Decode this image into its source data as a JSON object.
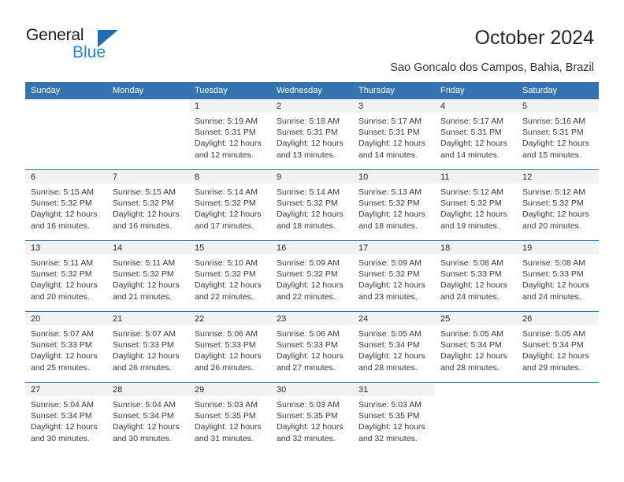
{
  "logo": {
    "word_top": "General",
    "word_bottom": "Blue",
    "triangle_color": "#1f6cb0",
    "blue_color": "#2288dd"
  },
  "header": {
    "title": "October 2024",
    "location": "Sao Goncalo dos Campos, Bahia, Brazil"
  },
  "theme": {
    "header_blue": "#3572b0",
    "daynum_band": "#f2f2f2"
  },
  "calendar": {
    "weekday_headers": [
      "Sunday",
      "Monday",
      "Tuesday",
      "Wednesday",
      "Thursday",
      "Friday",
      "Saturday"
    ],
    "weeks": [
      [
        {
          "day": "",
          "blank": true
        },
        {
          "day": "",
          "blank": true
        },
        {
          "day": "1",
          "sunrise": "Sunrise: 5:19 AM",
          "sunset": "Sunset: 5:31 PM",
          "daylight1": "Daylight: 12 hours",
          "daylight2": "and 12 minutes."
        },
        {
          "day": "2",
          "sunrise": "Sunrise: 5:18 AM",
          "sunset": "Sunset: 5:31 PM",
          "daylight1": "Daylight: 12 hours",
          "daylight2": "and 13 minutes."
        },
        {
          "day": "3",
          "sunrise": "Sunrise: 5:17 AM",
          "sunset": "Sunset: 5:31 PM",
          "daylight1": "Daylight: 12 hours",
          "daylight2": "and 14 minutes."
        },
        {
          "day": "4",
          "sunrise": "Sunrise: 5:17 AM",
          "sunset": "Sunset: 5:31 PM",
          "daylight1": "Daylight: 12 hours",
          "daylight2": "and 14 minutes."
        },
        {
          "day": "5",
          "sunrise": "Sunrise: 5:16 AM",
          "sunset": "Sunset: 5:31 PM",
          "daylight1": "Daylight: 12 hours",
          "daylight2": "and 15 minutes."
        }
      ],
      [
        {
          "day": "6",
          "sunrise": "Sunrise: 5:15 AM",
          "sunset": "Sunset: 5:32 PM",
          "daylight1": "Daylight: 12 hours",
          "daylight2": "and 16 minutes."
        },
        {
          "day": "7",
          "sunrise": "Sunrise: 5:15 AM",
          "sunset": "Sunset: 5:32 PM",
          "daylight1": "Daylight: 12 hours",
          "daylight2": "and 16 minutes."
        },
        {
          "day": "8",
          "sunrise": "Sunrise: 5:14 AM",
          "sunset": "Sunset: 5:32 PM",
          "daylight1": "Daylight: 12 hours",
          "daylight2": "and 17 minutes."
        },
        {
          "day": "9",
          "sunrise": "Sunrise: 5:14 AM",
          "sunset": "Sunset: 5:32 PM",
          "daylight1": "Daylight: 12 hours",
          "daylight2": "and 18 minutes."
        },
        {
          "day": "10",
          "sunrise": "Sunrise: 5:13 AM",
          "sunset": "Sunset: 5:32 PM",
          "daylight1": "Daylight: 12 hours",
          "daylight2": "and 18 minutes."
        },
        {
          "day": "11",
          "sunrise": "Sunrise: 5:12 AM",
          "sunset": "Sunset: 5:32 PM",
          "daylight1": "Daylight: 12 hours",
          "daylight2": "and 19 minutes."
        },
        {
          "day": "12",
          "sunrise": "Sunrise: 5:12 AM",
          "sunset": "Sunset: 5:32 PM",
          "daylight1": "Daylight: 12 hours",
          "daylight2": "and 20 minutes."
        }
      ],
      [
        {
          "day": "13",
          "sunrise": "Sunrise: 5:11 AM",
          "sunset": "Sunset: 5:32 PM",
          "daylight1": "Daylight: 12 hours",
          "daylight2": "and 20 minutes."
        },
        {
          "day": "14",
          "sunrise": "Sunrise: 5:11 AM",
          "sunset": "Sunset: 5:32 PM",
          "daylight1": "Daylight: 12 hours",
          "daylight2": "and 21 minutes."
        },
        {
          "day": "15",
          "sunrise": "Sunrise: 5:10 AM",
          "sunset": "Sunset: 5:32 PM",
          "daylight1": "Daylight: 12 hours",
          "daylight2": "and 22 minutes."
        },
        {
          "day": "16",
          "sunrise": "Sunrise: 5:09 AM",
          "sunset": "Sunset: 5:32 PM",
          "daylight1": "Daylight: 12 hours",
          "daylight2": "and 22 minutes."
        },
        {
          "day": "17",
          "sunrise": "Sunrise: 5:09 AM",
          "sunset": "Sunset: 5:32 PM",
          "daylight1": "Daylight: 12 hours",
          "daylight2": "and 23 minutes."
        },
        {
          "day": "18",
          "sunrise": "Sunrise: 5:08 AM",
          "sunset": "Sunset: 5:33 PM",
          "daylight1": "Daylight: 12 hours",
          "daylight2": "and 24 minutes."
        },
        {
          "day": "19",
          "sunrise": "Sunrise: 5:08 AM",
          "sunset": "Sunset: 5:33 PM",
          "daylight1": "Daylight: 12 hours",
          "daylight2": "and 24 minutes."
        }
      ],
      [
        {
          "day": "20",
          "sunrise": "Sunrise: 5:07 AM",
          "sunset": "Sunset: 5:33 PM",
          "daylight1": "Daylight: 12 hours",
          "daylight2": "and 25 minutes."
        },
        {
          "day": "21",
          "sunrise": "Sunrise: 5:07 AM",
          "sunset": "Sunset: 5:33 PM",
          "daylight1": "Daylight: 12 hours",
          "daylight2": "and 26 minutes."
        },
        {
          "day": "22",
          "sunrise": "Sunrise: 5:06 AM",
          "sunset": "Sunset: 5:33 PM",
          "daylight1": "Daylight: 12 hours",
          "daylight2": "and 26 minutes."
        },
        {
          "day": "23",
          "sunrise": "Sunrise: 5:06 AM",
          "sunset": "Sunset: 5:33 PM",
          "daylight1": "Daylight: 12 hours",
          "daylight2": "and 27 minutes."
        },
        {
          "day": "24",
          "sunrise": "Sunrise: 5:05 AM",
          "sunset": "Sunset: 5:34 PM",
          "daylight1": "Daylight: 12 hours",
          "daylight2": "and 28 minutes."
        },
        {
          "day": "25",
          "sunrise": "Sunrise: 5:05 AM",
          "sunset": "Sunset: 5:34 PM",
          "daylight1": "Daylight: 12 hours",
          "daylight2": "and 28 minutes."
        },
        {
          "day": "26",
          "sunrise": "Sunrise: 5:05 AM",
          "sunset": "Sunset: 5:34 PM",
          "daylight1": "Daylight: 12 hours",
          "daylight2": "and 29 minutes."
        }
      ],
      [
        {
          "day": "27",
          "sunrise": "Sunrise: 5:04 AM",
          "sunset": "Sunset: 5:34 PM",
          "daylight1": "Daylight: 12 hours",
          "daylight2": "and 30 minutes."
        },
        {
          "day": "28",
          "sunrise": "Sunrise: 5:04 AM",
          "sunset": "Sunset: 5:34 PM",
          "daylight1": "Daylight: 12 hours",
          "daylight2": "and 30 minutes."
        },
        {
          "day": "29",
          "sunrise": "Sunrise: 5:03 AM",
          "sunset": "Sunset: 5:35 PM",
          "daylight1": "Daylight: 12 hours",
          "daylight2": "and 31 minutes."
        },
        {
          "day": "30",
          "sunrise": "Sunrise: 5:03 AM",
          "sunset": "Sunset: 5:35 PM",
          "daylight1": "Daylight: 12 hours",
          "daylight2": "and 32 minutes."
        },
        {
          "day": "31",
          "sunrise": "Sunrise: 5:03 AM",
          "sunset": "Sunset: 5:35 PM",
          "daylight1": "Daylight: 12 hours",
          "daylight2": "and 32 minutes."
        },
        {
          "day": "",
          "blank": true
        },
        {
          "day": "",
          "blank": true
        }
      ]
    ]
  }
}
